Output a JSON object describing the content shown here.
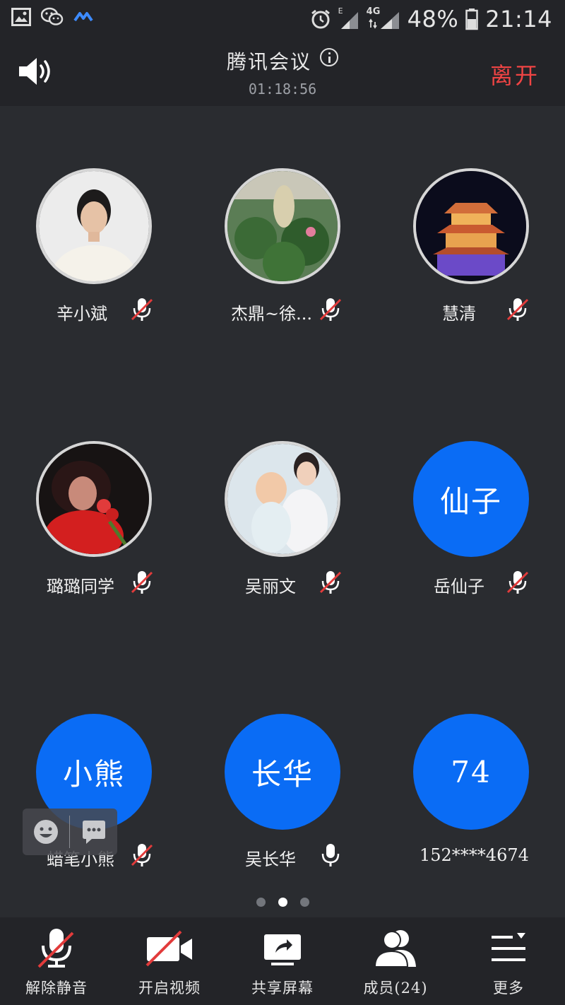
{
  "status_bar": {
    "battery": "48%",
    "time": "21:14",
    "network_1": "E",
    "network_2": "4G"
  },
  "header": {
    "title": "腾讯会议",
    "timer": "01:18:56",
    "leave_label": "离开"
  },
  "participants": [
    {
      "name": "辛小斌",
      "avatar_text": "",
      "avatar_type": "photo",
      "mic_muted": true
    },
    {
      "name": "杰鼎~徐...",
      "avatar_text": "",
      "avatar_type": "photo",
      "mic_muted": true
    },
    {
      "name": "慧清",
      "avatar_text": "",
      "avatar_type": "photo",
      "mic_muted": true
    },
    {
      "name": "璐璐同学",
      "avatar_text": "",
      "avatar_type": "photo",
      "mic_muted": true
    },
    {
      "name": "吴丽文",
      "avatar_text": "",
      "avatar_type": "photo",
      "mic_muted": true
    },
    {
      "name": "岳仙子",
      "avatar_text": "仙子",
      "avatar_type": "text",
      "mic_muted": true
    },
    {
      "name": "蜡笔小熊",
      "avatar_text": "小熊",
      "avatar_type": "text",
      "mic_muted": true
    },
    {
      "name": "吴长华",
      "avatar_text": "长华",
      "avatar_type": "text",
      "mic_muted": false
    },
    {
      "name": "152****4674",
      "avatar_text": "74",
      "avatar_type": "text",
      "mic_muted": null
    }
  ],
  "pager": {
    "count": 3,
    "active_index": 1
  },
  "toolbar": {
    "unmute": "解除静音",
    "video": "开启视频",
    "share": "共享屏幕",
    "members": "成员(24)",
    "more": "更多"
  },
  "colors": {
    "accent_blue": "#0a6cf5",
    "leave_red": "#ef4444",
    "background": "#2a2c30",
    "bar": "#232428"
  }
}
